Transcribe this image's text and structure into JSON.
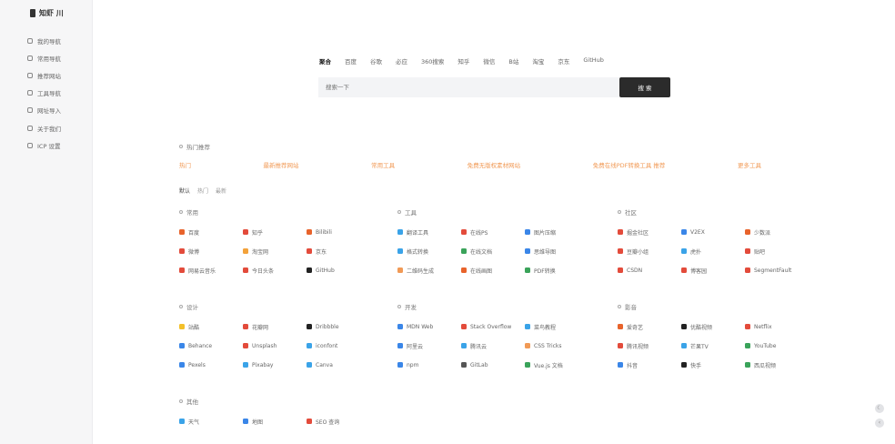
{
  "brand": {
    "name": "知虾 川"
  },
  "sidebar": {
    "items": [
      {
        "label": "我的导航"
      },
      {
        "label": "常用导航"
      },
      {
        "label": "推荐网站"
      },
      {
        "label": "工具导航"
      },
      {
        "label": "网址导入"
      },
      {
        "label": "关于我们"
      },
      {
        "label": "ICP 设置"
      }
    ]
  },
  "search": {
    "tabs": [
      "聚合",
      "百度",
      "谷歌",
      "必应",
      "360搜索",
      "知乎",
      "微信",
      "B站",
      "淘宝",
      "京东",
      "GitHub"
    ],
    "placeholder": "搜索一下",
    "button": "搜 索"
  },
  "hot": {
    "title": "热门推荐",
    "items": [
      "热门",
      "最新推荐网站",
      "常用工具",
      "免费无版权素材网站",
      "免费在线PDF转换工具 推荐",
      "更多工具"
    ]
  },
  "filter": {
    "items": [
      "默认",
      "热门",
      "最新"
    ]
  },
  "groups": [
    {
      "title": "常用",
      "sites": [
        {
          "label": "百度",
          "color": "#e8632b"
        },
        {
          "label": "知乎",
          "color": "#e34b3b"
        },
        {
          "label": "Bilibili",
          "color": "#e8632b"
        },
        {
          "label": "微博",
          "color": "#e34b3b"
        },
        {
          "label": "淘宝网",
          "color": "#f3a23a"
        },
        {
          "label": "京东",
          "color": "#e34b3b"
        },
        {
          "label": "网易云音乐",
          "color": "#e34b3b"
        },
        {
          "label": "今日头条",
          "color": "#e34b3b"
        },
        {
          "label": "GitHub",
          "color": "#222222"
        }
      ]
    },
    {
      "title": "工具",
      "sites": [
        {
          "label": "翻译工具",
          "color": "#3aa3e8"
        },
        {
          "label": "在线PS",
          "color": "#e34b3b"
        },
        {
          "label": "图片压缩",
          "color": "#3a86e8"
        },
        {
          "label": "格式转换",
          "color": "#3aa3e8"
        },
        {
          "label": "在线文档",
          "color": "#3aa35a"
        },
        {
          "label": "思维导图",
          "color": "#3a86e8"
        },
        {
          "label": "二维码生成",
          "color": "#f19a56"
        },
        {
          "label": "在线画图",
          "color": "#e8632b"
        },
        {
          "label": "PDF转换",
          "color": "#3aa35a"
        }
      ]
    },
    {
      "title": "社区",
      "sites": [
        {
          "label": "掘金社区",
          "color": "#e34b3b"
        },
        {
          "label": "V2EX",
          "color": "#3a86e8"
        },
        {
          "label": "少数派",
          "color": "#e8632b"
        },
        {
          "label": "豆瓣小组",
          "color": "#e34b3b"
        },
        {
          "label": "虎扑",
          "color": "#3aa3e8"
        },
        {
          "label": "贴吧",
          "color": "#e34b3b"
        },
        {
          "label": "CSDN",
          "color": "#e34b3b"
        },
        {
          "label": "博客园",
          "color": "#e34b3b"
        },
        {
          "label": "SegmentFault",
          "color": "#e34b3b"
        }
      ]
    },
    {
      "title": "设计",
      "sites": [
        {
          "label": "站酷",
          "color": "#f3c02a"
        },
        {
          "label": "花瓣网",
          "color": "#e34b3b"
        },
        {
          "label": "Dribbble",
          "color": "#222222"
        },
        {
          "label": "Behance",
          "color": "#3a86e8"
        },
        {
          "label": "Unsplash",
          "color": "#e34b3b"
        },
        {
          "label": "iconfont",
          "color": "#3aa3e8"
        },
        {
          "label": "Pexels",
          "color": "#3a86e8"
        },
        {
          "label": "Pixabay",
          "color": "#3aa3e8"
        },
        {
          "label": "Canva",
          "color": "#3aa3e8"
        }
      ]
    },
    {
      "title": "开发",
      "sites": [
        {
          "label": "MDN Web",
          "color": "#3a86e8"
        },
        {
          "label": "Stack Overflow",
          "color": "#e34b3b"
        },
        {
          "label": "菜鸟教程",
          "color": "#3aa3e8"
        },
        {
          "label": "阿里云",
          "color": "#3a86e8"
        },
        {
          "label": "腾讯云",
          "color": "#3aa3e8"
        },
        {
          "label": "CSS Tricks",
          "color": "#f19a56"
        },
        {
          "label": "npm",
          "color": "#3a86e8"
        },
        {
          "label": "GitLab",
          "color": "#555555"
        },
        {
          "label": "Vue.js 文档",
          "color": "#3aa35a"
        }
      ]
    },
    {
      "title": "影音",
      "sites": [
        {
          "label": "爱奇艺",
          "color": "#e8632b"
        },
        {
          "label": "优酷视频",
          "color": "#222222"
        },
        {
          "label": "Netflix",
          "color": "#e34b3b"
        },
        {
          "label": "腾讯视频",
          "color": "#e34b3b"
        },
        {
          "label": "芒果TV",
          "color": "#3aa3e8"
        },
        {
          "label": "YouTube",
          "color": "#3aa35a"
        },
        {
          "label": "抖音",
          "color": "#3a86e8"
        },
        {
          "label": "快手",
          "color": "#222222"
        },
        {
          "label": "西瓜视频",
          "color": "#3aa35a"
        }
      ]
    },
    {
      "title": "其他",
      "sites": [
        {
          "label": "天气",
          "color": "#3aa3e8"
        },
        {
          "label": "地图",
          "color": "#3a86e8"
        },
        {
          "label": "SEO 查询",
          "color": "#e34b3b"
        }
      ]
    }
  ]
}
